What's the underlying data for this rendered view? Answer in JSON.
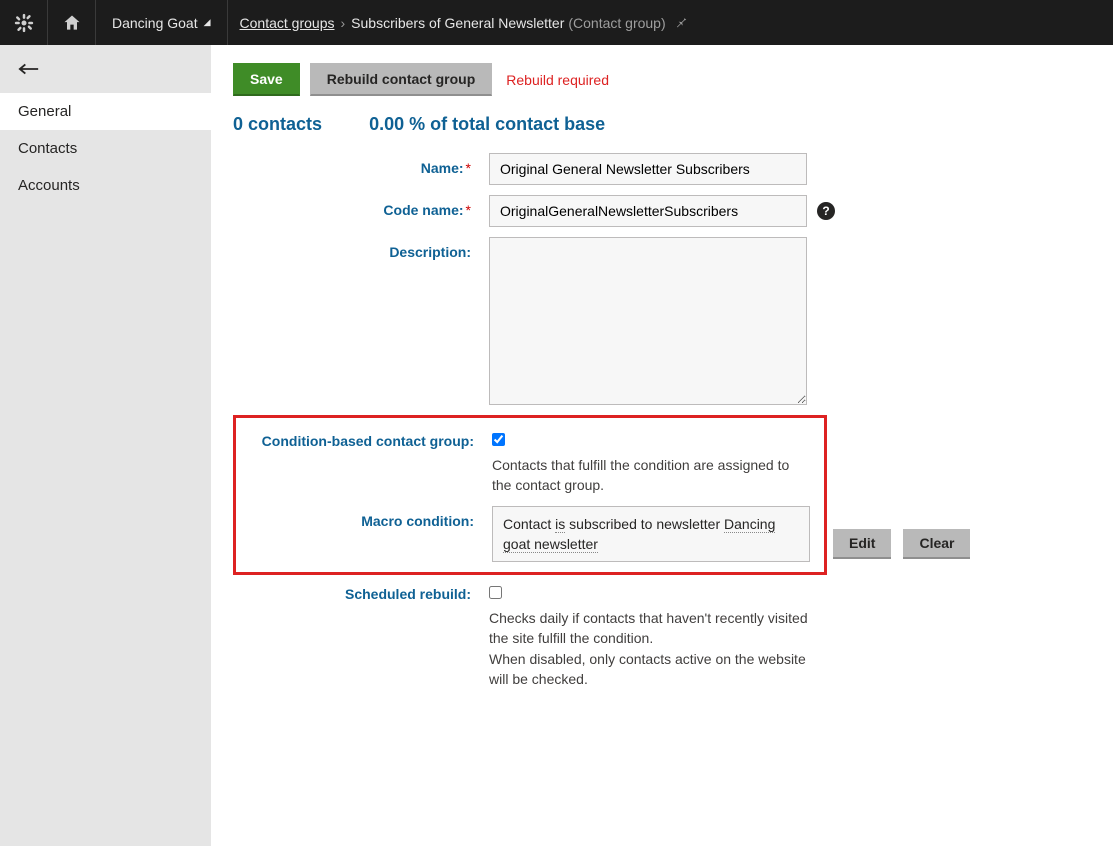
{
  "topbar": {
    "site": "Dancing Goat",
    "breadcrumb_root": "Contact groups",
    "breadcrumb_current": "Subscribers of General Newsletter",
    "breadcrumb_suffix": "(Contact group)"
  },
  "sidebar": {
    "items": [
      {
        "label": "General",
        "active": true
      },
      {
        "label": "Contacts",
        "active": false
      },
      {
        "label": "Accounts",
        "active": false
      }
    ]
  },
  "actions": {
    "save": "Save",
    "rebuild": "Rebuild contact group",
    "status": "Rebuild required"
  },
  "stats": {
    "contacts": "0 contacts",
    "percent": "0.00 % of total contact base"
  },
  "form": {
    "name_label": "Name:",
    "name_value": "Original General Newsletter Subscribers",
    "code_label": "Code name:",
    "code_value": "OriginalGeneralNewsletterSubscribers",
    "desc_label": "Description:",
    "desc_value": "",
    "condition_label": "Condition-based contact group:",
    "condition_checked": true,
    "condition_help": "Contacts that fulfill the condition are assigned to the contact group.",
    "macro_label": "Macro condition:",
    "macro_prefix": "Contact ",
    "macro_mid1": "is",
    "macro_mid2": " subscribed to newsletter ",
    "macro_tail": "Dancing goat newsletter",
    "edit_btn": "Edit",
    "clear_btn": "Clear",
    "sched_label": "Scheduled rebuild:",
    "sched_checked": false,
    "sched_help1": "Checks daily if contacts that haven't recently visited the site fulfill the condition.",
    "sched_help2": "When disabled, only contacts active on the website will be checked."
  }
}
